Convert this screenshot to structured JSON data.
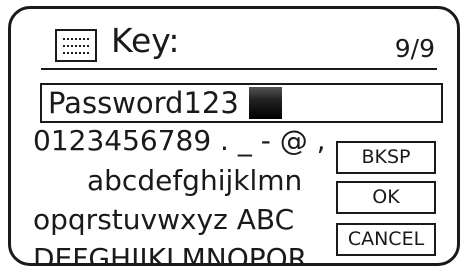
{
  "header": {
    "icon": "keyboard-icon",
    "title": "Key:",
    "counter": "9/9"
  },
  "entry": {
    "value": "Password123"
  },
  "keyboard": {
    "rows": [
      "0123456789 . _ - @ ,",
      "abcdefghijklmn",
      "opqrstuvwxyz ABC",
      "DEFGHIJKLMNOPQR"
    ]
  },
  "buttons": {
    "backspace": "BKSP",
    "ok": "OK",
    "cancel": "CANCEL"
  }
}
